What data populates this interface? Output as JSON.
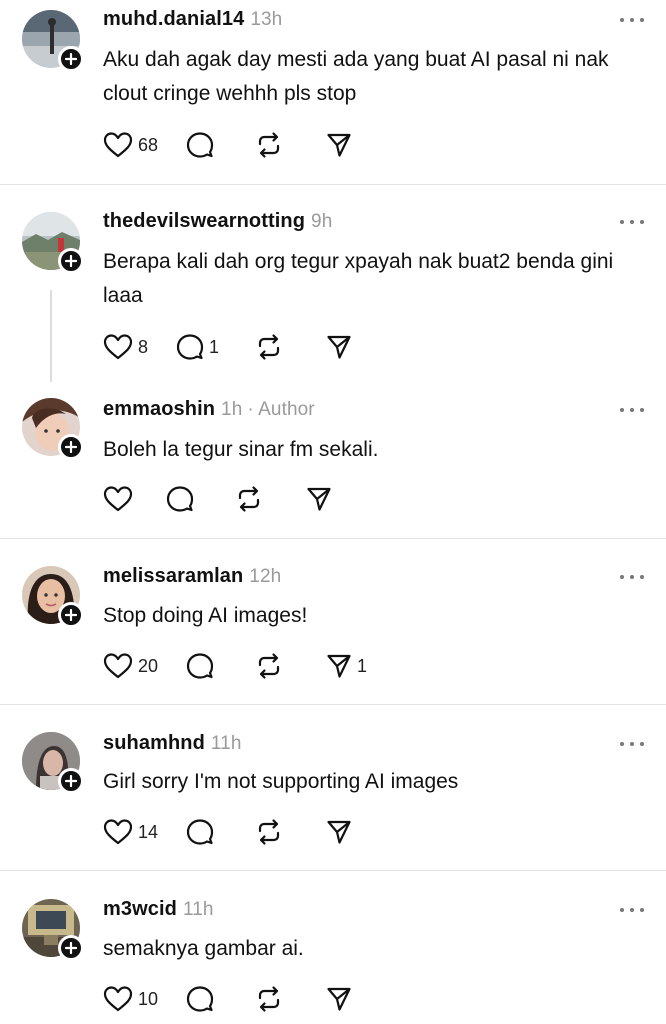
{
  "replies": [
    {
      "username": "muhd.danial14",
      "time": "13h",
      "text": "Aku dah agak day mesti ada yang buat AI pasal ni nak clout cringe wehhh pls stop",
      "likes": "68",
      "replies": "",
      "reposts": "",
      "shares": ""
    },
    {
      "username": "thedevilswearnotting",
      "time": "9h",
      "text": "Berapa kali dah org tegur xpayah nak buat2 benda gini laaa",
      "likes": "8",
      "replies": "1",
      "reposts": "",
      "shares": ""
    },
    {
      "username": "emmaoshin",
      "time": "1h",
      "author_badge": "· Author",
      "text": "Boleh la tegur sinar fm sekali.",
      "likes": "",
      "replies": "",
      "reposts": "",
      "shares": ""
    },
    {
      "username": "melissaramlan",
      "time": "12h",
      "text": "Stop doing AI images!",
      "likes": "20",
      "replies": "",
      "reposts": "",
      "shares": "1"
    },
    {
      "username": "suhamhnd",
      "time": "11h",
      "text": "Girl sorry I'm not supporting AI images",
      "likes": "14",
      "replies": "",
      "reposts": "",
      "shares": ""
    },
    {
      "username": "m3wcid",
      "time": "11h",
      "text": "semaknya gambar ai.",
      "likes": "10",
      "replies": "",
      "reposts": "",
      "shares": ""
    }
  ],
  "icons": {
    "like": "heart-icon",
    "reply": "speech-bubble-icon",
    "repost": "repost-icon",
    "share": "send-icon",
    "more": "more-horizontal-icon",
    "follow": "plus-icon"
  },
  "colors": {
    "text": "#111111",
    "meta": "#9a9a9a",
    "divider": "#e4e4e4",
    "background": "#ffffff"
  }
}
